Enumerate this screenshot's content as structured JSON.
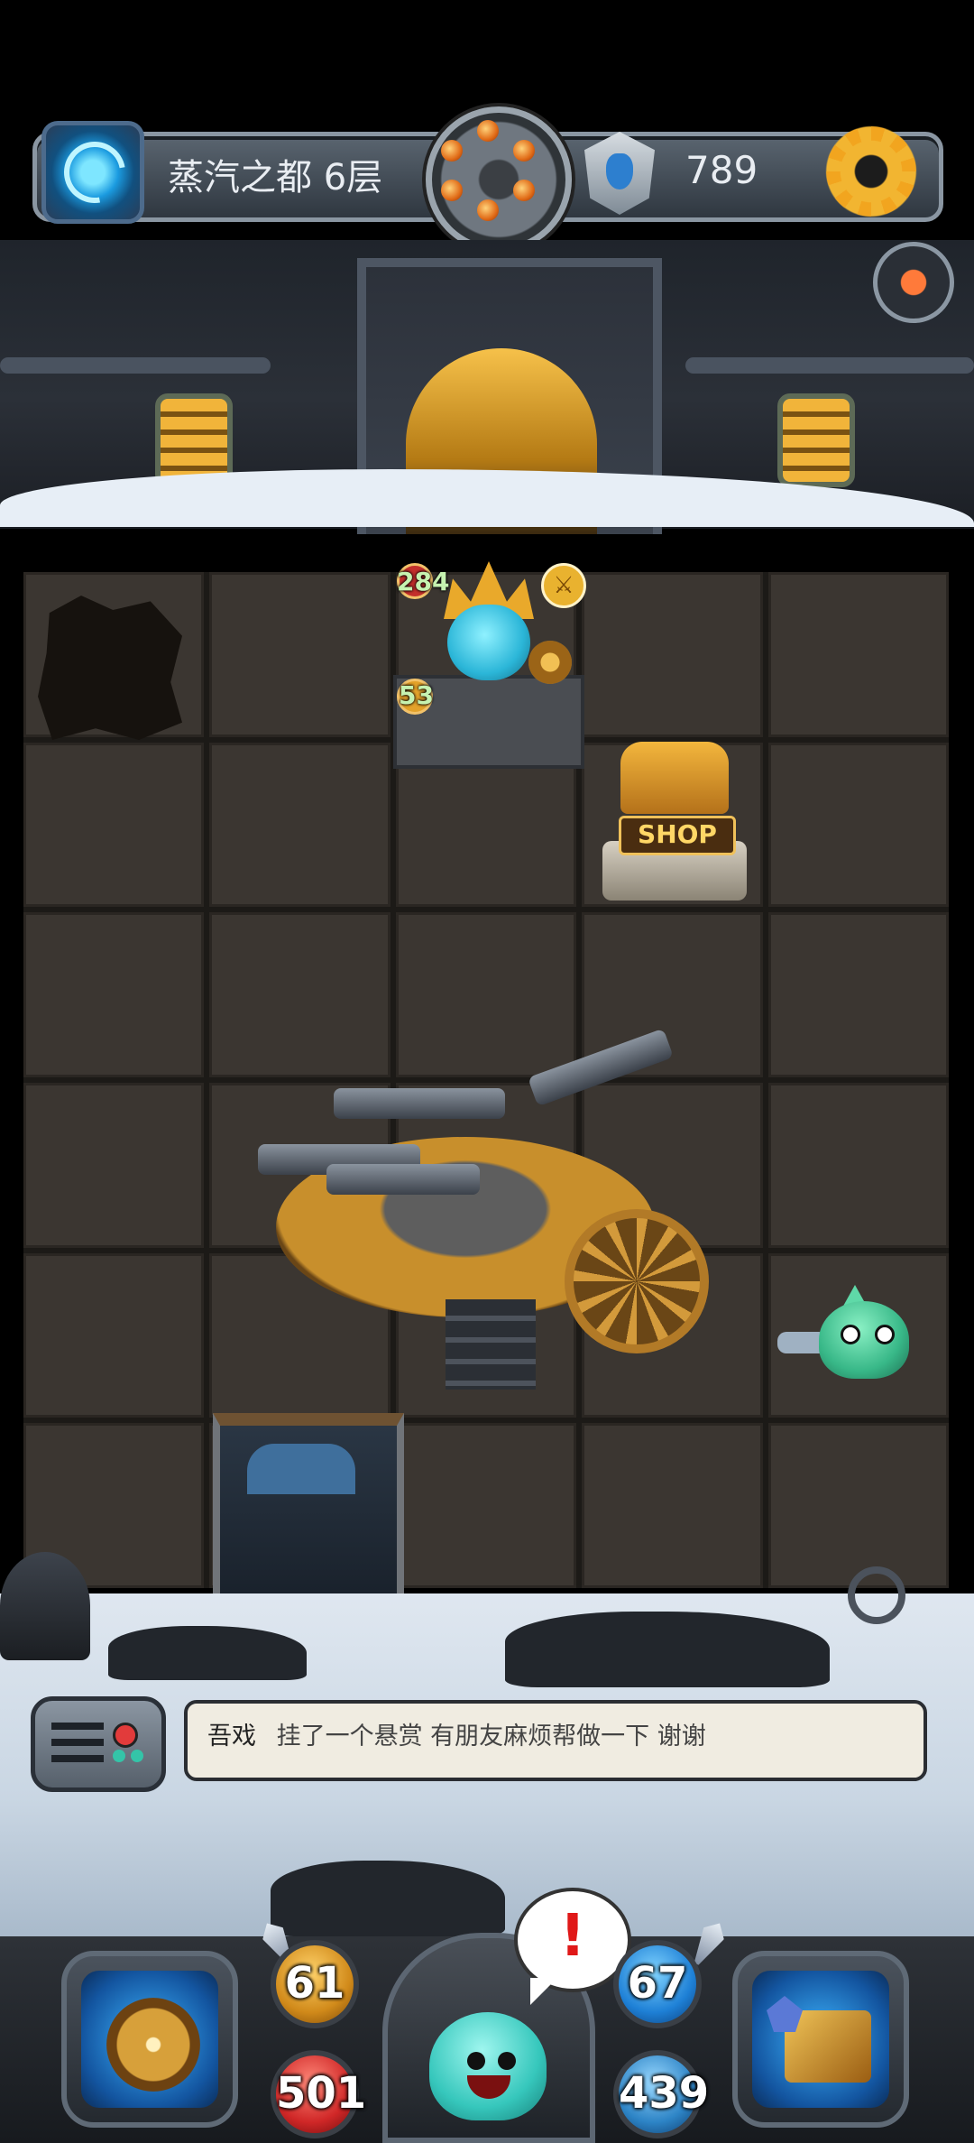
{
  "topbar": {
    "floor_label": "蒸汽之都 6层",
    "currency_value": "789",
    "portal_icon": "portal-icon",
    "cylinder_icon": "revolver-cylinder-icon",
    "currency_icon": "crystal-icon",
    "settings_icon": "gear-icon"
  },
  "board": {
    "boss": {
      "hp": "284",
      "attack": "53"
    },
    "shop_sign": "SHOP"
  },
  "chat": {
    "name": "吾戏",
    "message": "挂了一个悬赏 有朋友麻烦帮做一下 谢谢"
  },
  "hud": {
    "attack": "61",
    "hp": "501",
    "defense": "67",
    "mp": "439",
    "alert": "!"
  },
  "colors": {
    "accent_gold": "#f2b531",
    "hp_red": "#d02727",
    "mana_blue": "#1e80d6",
    "chat_bg": "#f0ece1"
  }
}
